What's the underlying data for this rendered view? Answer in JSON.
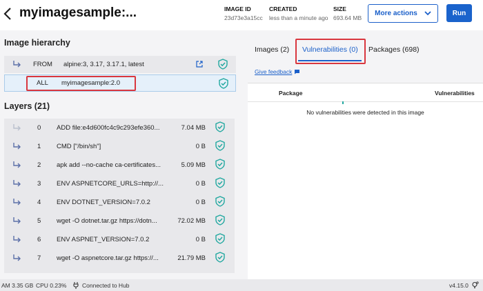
{
  "header": {
    "title": "myimagesample:...",
    "image_id_label": "IMAGE ID",
    "image_id": "23d73e3a15cc",
    "created_label": "CREATED",
    "created": "less than a minute ago",
    "size_label": "SIZE",
    "size": "693.64 MB",
    "more_actions": "More actions",
    "run": "Run"
  },
  "hierarchy": {
    "title": "Image hierarchy",
    "rows": [
      {
        "keyword": "FROM",
        "name": "alpine:3, 3.17, 3.17.1, latest"
      },
      {
        "keyword": "ALL",
        "name": "myimagesample:2.0"
      }
    ]
  },
  "layers": {
    "title": "Layers (21)",
    "items": [
      {
        "index": "0",
        "command": "ADD file:e4d600fc4c9c293efe360...",
        "size": "7.04 MB"
      },
      {
        "index": "1",
        "command": "CMD [\"/bin/sh\"]",
        "size": "0 B"
      },
      {
        "index": "2",
        "command": "apk add --no-cache ca-certificates...",
        "size": "5.09 MB"
      },
      {
        "index": "3",
        "command": "ENV ASPNETCORE_URLS=http://...",
        "size": "0 B"
      },
      {
        "index": "4",
        "command": "ENV DOTNET_VERSION=7.0.2",
        "size": "0 B"
      },
      {
        "index": "5",
        "command": "wget -O dotnet.tar.gz https://dotn...",
        "size": "72.02 MB"
      },
      {
        "index": "6",
        "command": "ENV ASPNET_VERSION=7.0.2",
        "size": "0 B"
      },
      {
        "index": "7",
        "command": "wget -O aspnetcore.tar.gz https://...",
        "size": "21.79 MB"
      }
    ]
  },
  "tabs": [
    {
      "label": "Images (2)"
    },
    {
      "label": "Vulnerabilities (0)"
    },
    {
      "label": "Packages (698)"
    }
  ],
  "feedback": "Give feedback",
  "vulnerabilities": {
    "col_package": "Package",
    "col_vulns": "Vulnerabilities",
    "empty_message": "No vulnerabilities were detected in this image"
  },
  "statusbar": {
    "ram": "AM 3.35 GB",
    "cpu": "CPU 0.23%",
    "hub": "Connected to Hub",
    "version": "v4.15.0"
  },
  "colors": {
    "accent": "#1a5fc9",
    "shield": "#21a8a0",
    "highlight": "#d9363e"
  }
}
